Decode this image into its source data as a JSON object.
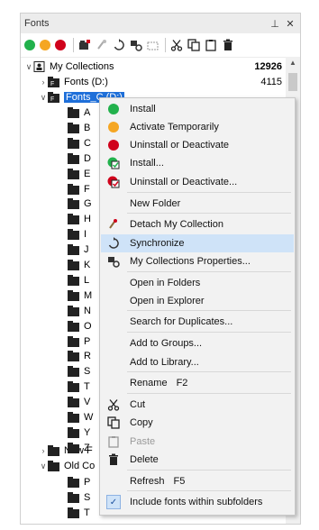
{
  "panel": {
    "title": "Fonts",
    "pin_glyph": "⊥",
    "close_glyph": "✕"
  },
  "toolbar": {
    "status_dots": [
      {
        "name": "green",
        "color": "#22b14c"
      },
      {
        "name": "orange",
        "color": "#f5a623"
      },
      {
        "name": "red",
        "color": "#d0021b"
      }
    ],
    "tools": [
      "add-collection-icon",
      "detach-icon",
      "synchronize-icon",
      "properties-icon",
      "folder-icon",
      "cut-icon",
      "copy-icon",
      "paste-icon",
      "delete-icon"
    ]
  },
  "tree": {
    "root": {
      "label": "My Collections",
      "count": "12926"
    },
    "fonts_d": {
      "label": "Fonts (D:)",
      "count": "4115"
    },
    "fonts_c": {
      "label": "Fonts_C (D:)"
    },
    "letters": [
      "A",
      "B",
      "C",
      "D",
      "E",
      "F",
      "G",
      "H",
      "I",
      "J",
      "K",
      "L",
      "M",
      "N",
      "O",
      "P",
      "R",
      "S",
      "T",
      "V",
      "W",
      "Y",
      "Z"
    ],
    "new_f": {
      "label": "New F"
    },
    "old_c": {
      "label": "Old Co"
    },
    "old_children": [
      "P",
      "S",
      "T"
    ]
  },
  "menu": {
    "items": [
      {
        "label": "Install",
        "icon": "green-dot"
      },
      {
        "label": "Activate Temporarily",
        "icon": "orange-dot"
      },
      {
        "label": "Uninstall or Deactivate",
        "icon": "red-dot"
      },
      {
        "label": "Install...",
        "icon": "install-dialog-icon"
      },
      {
        "label": "Uninstall or Deactivate...",
        "icon": "uninstall-dialog-icon"
      },
      {
        "label": "New Folder",
        "icon": ""
      },
      {
        "label": "Detach My Collection",
        "icon": "detach-icon"
      },
      {
        "label": "Synchronize",
        "icon": "synchronize-icon"
      },
      {
        "label": "My Collections Properties...",
        "icon": "properties-icon"
      },
      {
        "label": "Open in Folders",
        "icon": ""
      },
      {
        "label": "Open in Explorer",
        "icon": ""
      },
      {
        "label": "Search for Duplicates...",
        "icon": ""
      },
      {
        "label": "Add to Groups...",
        "icon": ""
      },
      {
        "label": "Add to Library...",
        "icon": ""
      },
      {
        "label": "Rename",
        "shortcut": "F2",
        "icon": ""
      },
      {
        "label": "Cut",
        "icon": "cut-icon"
      },
      {
        "label": "Copy",
        "icon": "copy-icon"
      },
      {
        "label": "Paste",
        "icon": "paste-icon"
      },
      {
        "label": "Delete",
        "icon": "delete-icon"
      },
      {
        "label": "Refresh",
        "shortcut": "F5",
        "icon": ""
      },
      {
        "label": "Include fonts within subfolders",
        "icon": "check-icon"
      }
    ]
  },
  "colors": {
    "selection": "#1e6fd9",
    "menu_bg": "#f2f2f2",
    "highlight": "#cfe3f8"
  }
}
